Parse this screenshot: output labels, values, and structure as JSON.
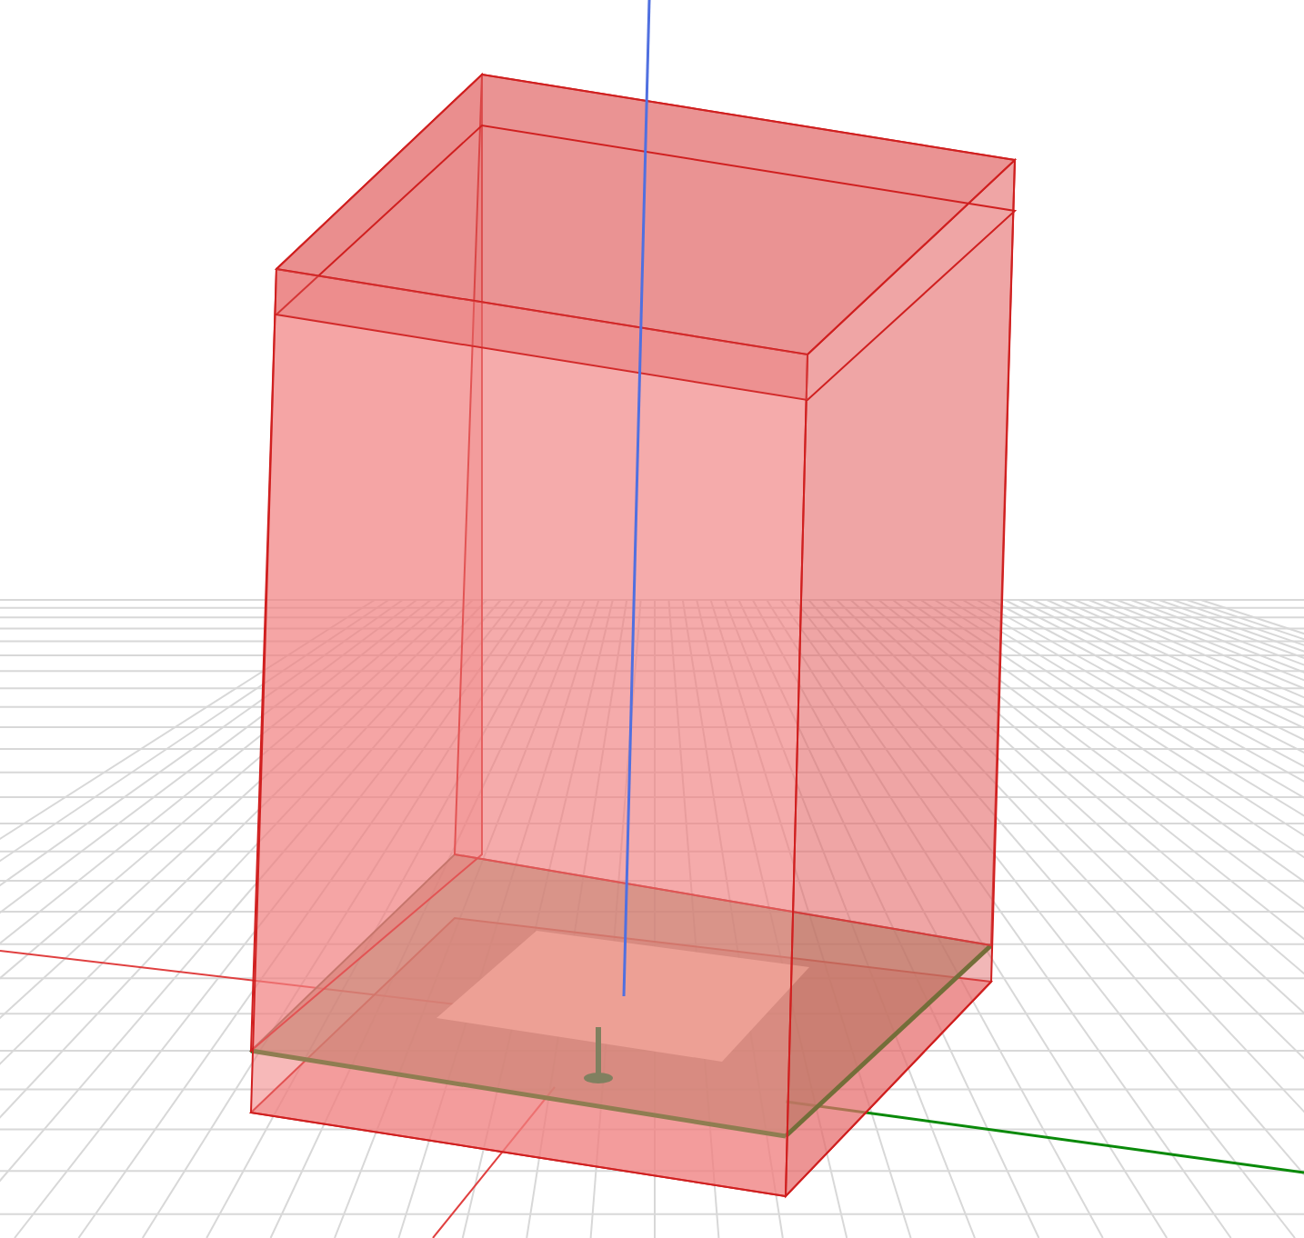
{
  "viewport": {
    "grid": true,
    "axes": true
  }
}
